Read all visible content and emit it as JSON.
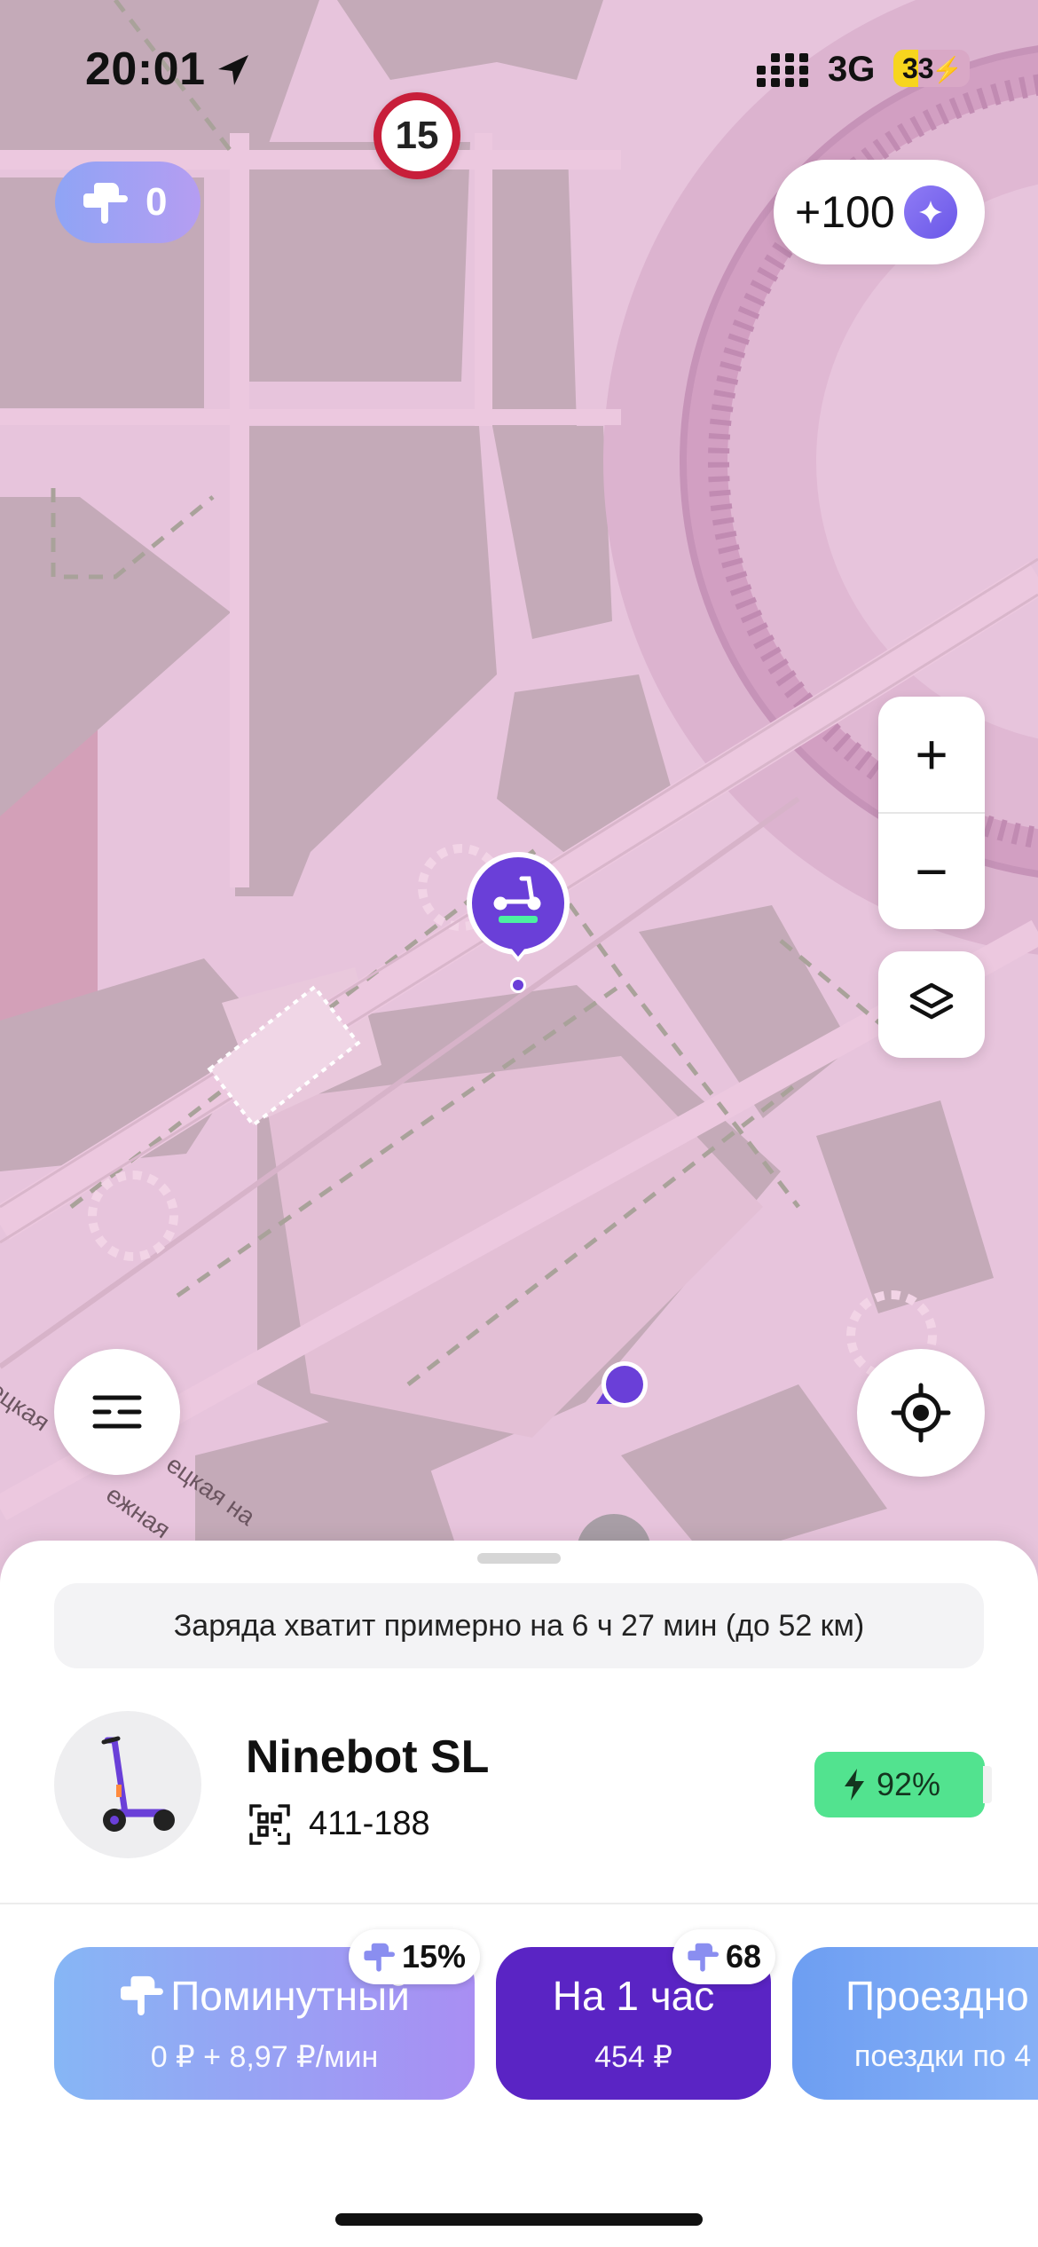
{
  "status_bar": {
    "time": "20:01",
    "network": "3G",
    "battery_percent": "33",
    "battery_level": 0.33
  },
  "map": {
    "speed_limit": "15",
    "points_balance": "0",
    "bonus": "+100",
    "street_labels": [
      "ецкая",
      "ежная",
      "ецкая на"
    ],
    "zoom_in": "+",
    "zoom_out": "−"
  },
  "sheet": {
    "range_text": "Заряда хватит примерно на 6 ч 27 мин (до 52 км)",
    "model": "Ninebot SL",
    "scooter_id": "411-188",
    "charge": "92%"
  },
  "tariffs": [
    {
      "title": "Поминутный",
      "price": "0 ₽ + 8,97 ₽/мин",
      "badge": "15%"
    },
    {
      "title": "На 1 час",
      "price": "454 ₽",
      "badge": "68"
    },
    {
      "title": "Проездно",
      "price": "поездки по 4"
    }
  ],
  "colors": {
    "accent_purple": "#5a24c4",
    "charge_green": "#52e38f",
    "speed_red": "#c81e3a",
    "map_tint": "#e9c5dd"
  }
}
